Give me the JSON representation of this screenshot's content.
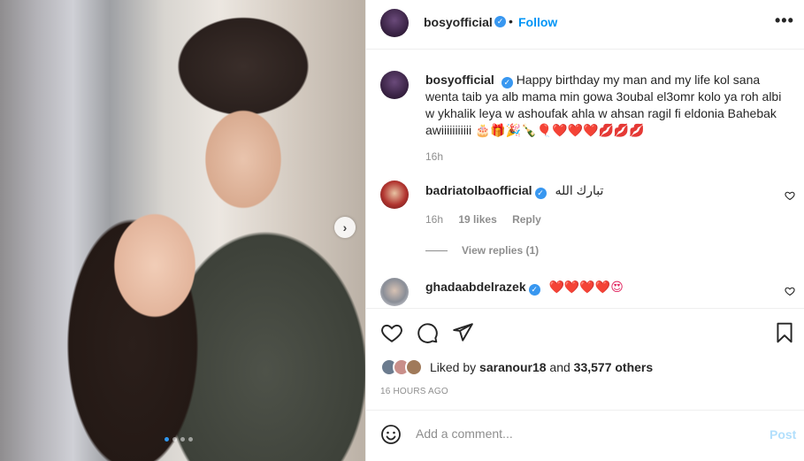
{
  "post": {
    "username": "bosyofficial",
    "follow_label": "Follow",
    "separator": "•",
    "more_label": "•••",
    "verified_mark": "✓",
    "photo_next_label": "›",
    "carousel": {
      "count": 4,
      "active_index": 0
    }
  },
  "caption": {
    "username": "bosyofficial",
    "text": "Happy birthday my man and my life kol sana wenta taib ya alb mama min gowa 3oubal el3omr kolo ya roh albi w ykhalik leya w ashoufak ahla w ahsan ragil fi eldonia Bahebak awiiiiiiiiiii 🎂🎁🎉🍾🎈❤️❤️❤️💋💋💋",
    "time": "16h"
  },
  "comments": [
    {
      "username": "badriatolbaofficial",
      "text": "تبارك الله",
      "time": "16h",
      "likes": "19 likes",
      "reply_label": "Reply",
      "view_replies": "View replies (1)",
      "like_icon": "heart-outline-icon"
    },
    {
      "username": "ghadaabdelrazek",
      "text": "❤️❤️❤️❤️😍",
      "like_icon": "heart-outline-icon"
    }
  ],
  "actions": {
    "icons": [
      "heart-outline-icon",
      "comment-icon",
      "share-icon",
      "bookmark-icon"
    ],
    "liked_by_prefix": "Liked by",
    "liked_by_user": "saranour18",
    "liked_by_and": "and",
    "liked_by_count": "33,577 others",
    "timestamp": "16 HOURS AGO"
  },
  "add_comment": {
    "placeholder": "Add a comment...",
    "post_label": "Post"
  },
  "colors": {
    "accent": "#0095f6",
    "verified": "#3897f0",
    "post_disabled": "#b2dffc",
    "muted": "#8e8e8e"
  }
}
